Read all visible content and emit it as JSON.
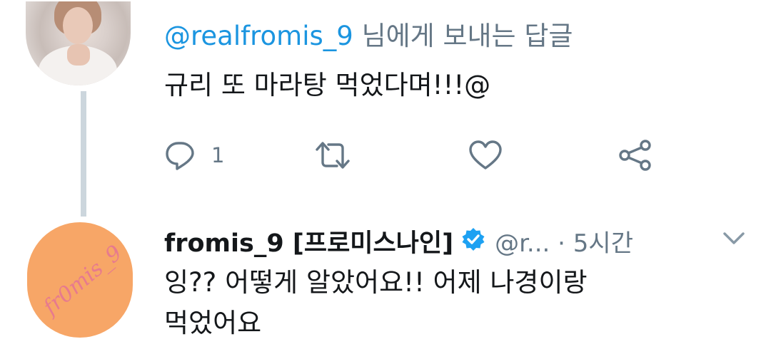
{
  "tweet1": {
    "reply_prefix": "@realfromis_9",
    "reply_suffix": " 님에게 보내는 답글",
    "text": "규리 또 마라탕 먹었다며!!!@",
    "reply_count": "1"
  },
  "tweet2": {
    "display_name": "fromis_9 [프로미스나인]",
    "handle_time": "@r... · 5시간",
    "avatar_text": "fr0mis_9",
    "text_line1": "잉?? 어떻게 알았어요!! 어제 나경이랑",
    "text_line2": "먹었어요"
  },
  "icons": [
    "reply-icon",
    "retweet-icon",
    "like-icon",
    "share-icon",
    "verified-badge-icon",
    "chevron-down-icon"
  ],
  "colors": {
    "link": "#1b95e0",
    "secondary": "#657786",
    "thread_line": "#ccd6dd",
    "verified": "#1da1f2"
  }
}
